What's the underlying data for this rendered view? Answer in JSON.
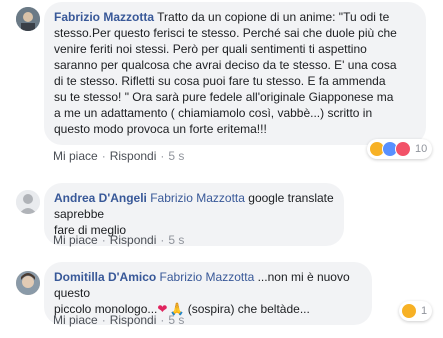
{
  "comments": [
    {
      "author": "Fabrizio Mazzotta",
      "mention": "",
      "text_lines": [
        "Tratto da un copione di un anime: \"Tu odi te",
        "stesso.Per questo ferisci te stesso. Perché sai che duole più che",
        "venire feriti noi stessi. Però per quali sentimenti ti aspettino",
        "saranno per qualcosa che avrai deciso da te stesso. E' una cosa",
        "di te stesso. Rifletti su cosa puoi fare tu stesso. E fa ammenda",
        "su te stesso! \" Ora sarà pure fedele all'originale Giapponese ma",
        "a me un adattamento ( chiamiamolo così, vabbè...) scritto in",
        "questo modo provoca un forte eritema!!!"
      ],
      "like_label": "Mi piace",
      "reply_label": "Rispondi",
      "time": "5 s",
      "reactions": {
        "icons": [
          "wow",
          "like",
          "love"
        ],
        "count": "10"
      }
    },
    {
      "author": "Andrea D'Angeli",
      "mention": "Fabrizio Mazzotta",
      "text_lines": [
        "google translate saprebbe",
        "fare di meglio"
      ],
      "like_label": "Mi piace",
      "reply_label": "Rispondi",
      "time": "5 s"
    },
    {
      "author": "Domitilla D'Amico",
      "mention": "Fabrizio Mazzotta",
      "text_lines": [
        "...non mi è nuovo questo",
        "piccolo monologo...",
        "(sospira) che beltàde..."
      ],
      "inline_emojis": [
        "❤",
        "🙏"
      ],
      "like_label": "Mi piace",
      "reply_label": "Rispondi",
      "time": "5 s",
      "reactions": {
        "icons": [
          "haha"
        ],
        "count": "1"
      }
    }
  ],
  "colors": {
    "author": "#385898",
    "bubble": "#f2f3f5",
    "meta": "#90949c",
    "like": "#5890ff",
    "love": "#f25268",
    "wow": "#f7b125"
  }
}
